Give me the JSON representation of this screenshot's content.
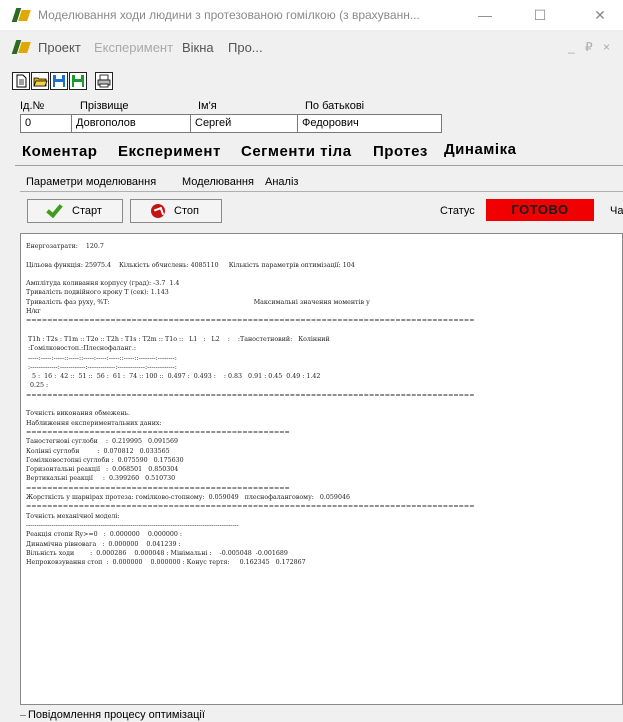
{
  "window": {
    "title": "Моделювання ходи людини з протезованою гомілкою (з врахуванн...",
    "minimize": "—",
    "maximize": "☐",
    "close": "✕"
  },
  "menu": {
    "items": [
      {
        "label": "Проект",
        "disabled": false
      },
      {
        "label": "Експеримент",
        "disabled": true
      },
      {
        "label": "Вікна",
        "disabled": false
      },
      {
        "label": "Про...",
        "disabled": false
      }
    ],
    "mdi_min": "_",
    "mdi_restore": "₽",
    "mdi_close": "×"
  },
  "toolbar": {
    "icons": [
      "new-document-icon",
      "open-folder-icon",
      "save-disk-icon",
      "save-as-disk-icon",
      "print-icon"
    ]
  },
  "patient": {
    "id_label": "Ід.№",
    "id_value": "0",
    "surname_label": "Прізвище",
    "surname_value": "Довгополов",
    "name_label": "Ім'я",
    "name_value": "Сергей",
    "patronymic_label": "По батькові",
    "patronymic_value": "Федорович"
  },
  "main_tabs": [
    "Коментар",
    "Експеримент",
    "Сегменти тіла",
    "Протез",
    "Динаміка"
  ],
  "active_main_tab": "Динаміка",
  "sub_tabs": [
    "Параметри моделювання",
    "Моделювання",
    "Аналіз"
  ],
  "active_sub_tab": "Моделювання",
  "actions": {
    "start_label": "Старт",
    "stop_label": "Стоп",
    "status_label": "Статус",
    "status_value": "ГОТОВО",
    "extra_label": "Ча"
  },
  "colors": {
    "status_bg": "#f00000",
    "start_icon": "#3e9d1c",
    "stop_icon": "#c41414"
  },
  "log": {
    "lines": [
      "Енергозатрати:    120.7",
      "",
      "Цільова функція: 25975.4    Кількість обчислень: 4085110     Кількість параметрів оптимізації: 104",
      "",
      "Амплітуда коливання корпусу (град): -3.7  1.4",
      "Тривалість подвійного кроку Т (сек): 1.143",
      "Тривалість фаз руху, %Т:                                                                        Максимальні значення моментів у",
      "Н/кг",
      "=====================================================================================",
      "",
      " T1h : T2s : T1m :: T2o :: T2h : T1s : T2m :: T1o ::   L1   :   L2    :    :Таностетновий:   Колінний",
      " :Гомілковостоп.:Плеснофаланг.:",
      " -----:-----:-----::-----::-----:-----:-----::-----::--------:--------:",
      " :-------------:------------:-------------:-------------:-------------:",
      "   5 :  16 :  42 ::  51 ::  56 :  61 :  74 :: 100 ::  0.497 :  0.493 :    : 0.83   0.91 : 0.45  0.49 : 1.42",
      "  0.25 :",
      "=====================================================================================",
      "",
      "Точність виконання обмежень.",
      "Наближення експериментальних даних:",
      "==================================================",
      "Таностегнові суглоби    :  0.219995   0.091569",
      "Колінні суглоби         :  0.070812   0.033565",
      "Гомілковостопні суглоби :  0.075590   0.175630",
      "Горизонтальні реакції   :  0.068501   0.850304",
      "Вертикальні реакції     :  0.399260   0.510730",
      "==================================================",
      "Жорсткість у шарнірах протеза: гомілково-стопному:  0.059049   плеснофаланговому:   0.059046",
      "=====================================================================================",
      "Точність механічної моделі:",
      "----------------------------------------------------------------------------------------------------",
      "Реакція стопи Ry>=0   :  0.000000    0.000000 :",
      "Динамічна рівновага   :  0.000000    0.041239 :",
      "Вільність ходи        :  0.000286    0.000048 : Мінімальні :    -0.005048  -0.001689",
      "Непроковзування стоп  :  0.000000    0.000000 : Конус тертя:     0.162345   0.172867"
    ]
  },
  "bottom_panel": {
    "label": "Повідомлення процесу оптимізації"
  }
}
